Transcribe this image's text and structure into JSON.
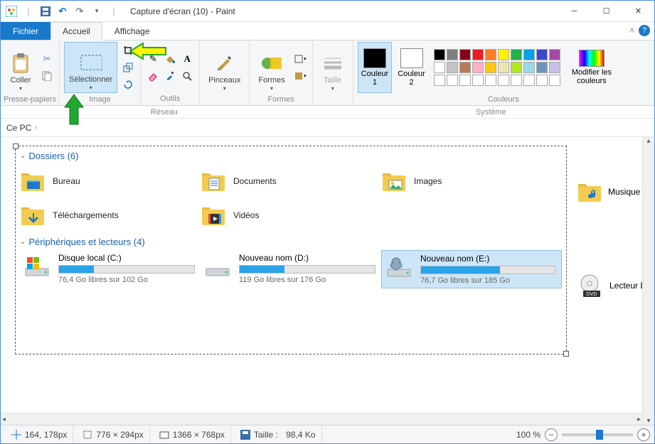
{
  "titlebar": {
    "title": "Capture d'écran (10) - Paint"
  },
  "tabs": {
    "file": "Fichier",
    "home": "Accueil",
    "view": "Affichage"
  },
  "ribbon": {
    "clipboard": {
      "paste": "Coller",
      "label": "Presse-papiers"
    },
    "image": {
      "select": "Sélectionner",
      "label": "Image"
    },
    "tools": {
      "label": "Outils"
    },
    "brushes": {
      "btn": "Pinceaux"
    },
    "shapes": {
      "btn": "Formes",
      "label": "Formes"
    },
    "size": {
      "btn": "Taille"
    },
    "colors": {
      "c1": "Couleur\n1",
      "c2": "Couleur\n2",
      "edit": "Modifier les\ncouleurs",
      "label": "Couleurs",
      "c1_swatch": "#000000",
      "c2_swatch": "#ffffff",
      "palette": [
        "#000000",
        "#7f7f7f",
        "#880015",
        "#ed1c24",
        "#ff7f27",
        "#fff200",
        "#22b14c",
        "#00a2e8",
        "#3f48cc",
        "#a349a4",
        "#ffffff",
        "#c3c3c3",
        "#b97a57",
        "#ffaec9",
        "#ffc90e",
        "#efe4b0",
        "#b5e61d",
        "#99d9ea",
        "#7092be",
        "#c8bfe7",
        "#ffffff",
        "#ffffff",
        "#ffffff",
        "#ffffff",
        "#ffffff",
        "#ffffff",
        "#ffffff",
        "#ffffff",
        "#ffffff",
        "#ffffff"
      ]
    }
  },
  "minibar": {
    "left": "Réseau",
    "right": "Système"
  },
  "breadcrumb": {
    "root": "Ce PC"
  },
  "sections": {
    "folders_head": "Dossiers (6)",
    "drives_head": "Périphériques et lecteurs (4)"
  },
  "folders": [
    {
      "name": "Bureau"
    },
    {
      "name": "Documents"
    },
    {
      "name": "Images"
    },
    {
      "name": "Téléchargements"
    },
    {
      "name": "Vidéos"
    }
  ],
  "extra_folder": {
    "name": "Musique"
  },
  "drives": [
    {
      "name": "Disque local (C:)",
      "sub": "76,4 Go libres sur 102 Go",
      "fill": 26
    },
    {
      "name": "Nouveau nom (D:)",
      "sub": "119 Go libres sur 176 Go",
      "fill": 33
    },
    {
      "name": "Nouveau nom (E:)",
      "sub": "76,7 Go libres sur 185 Go",
      "fill": 59,
      "selected": true
    }
  ],
  "extra_drive": {
    "name": "Lecteur D"
  },
  "status": {
    "pointer": "164, 178px",
    "selection": "776 × 294px",
    "canvas": "1366 × 768px",
    "size_label": "Taille :",
    "size_value": "98,4 Ko",
    "zoom": "100 %"
  }
}
